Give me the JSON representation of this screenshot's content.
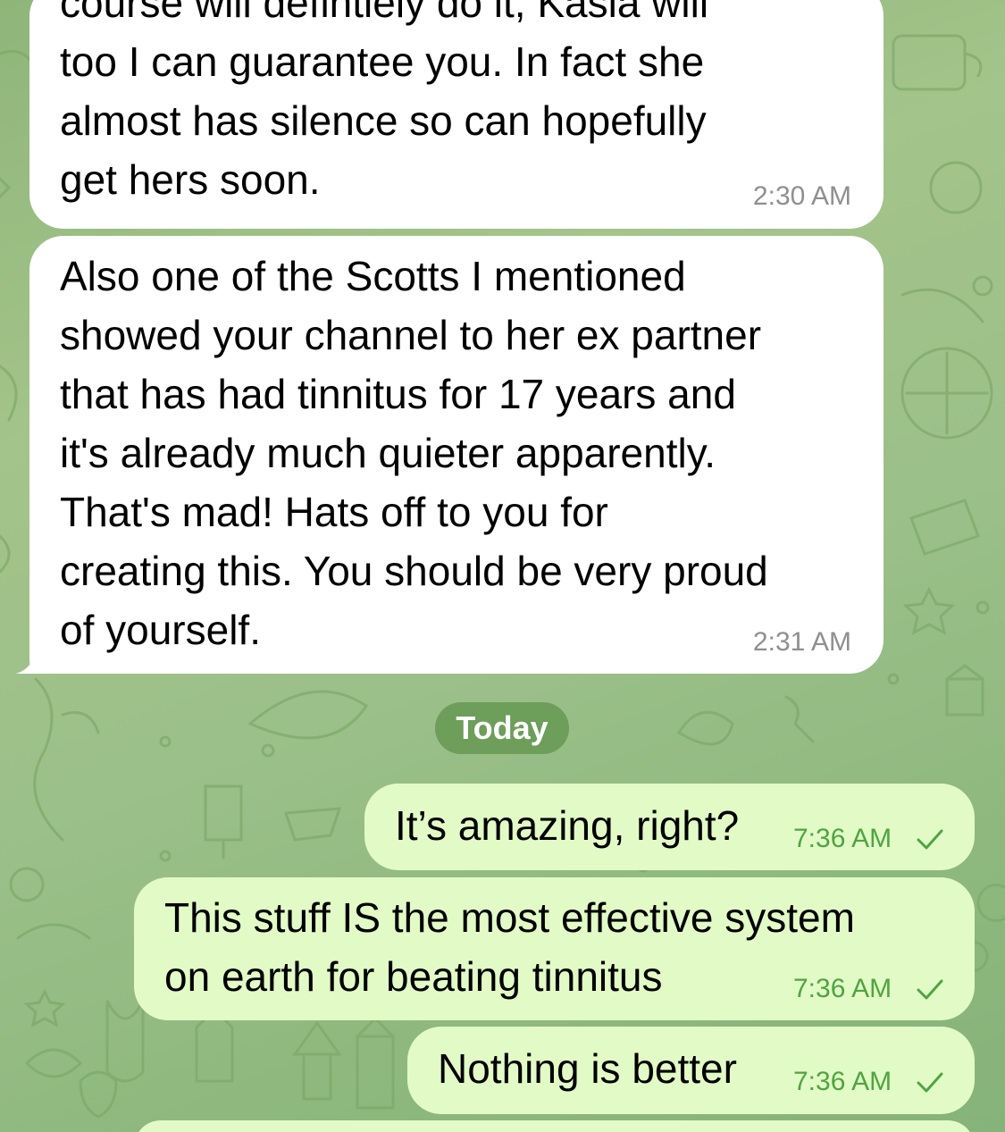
{
  "theme": {
    "incoming_bubble_color": "#ffffff",
    "outgoing_bubble_color": "#e2fbc6",
    "outgoing_time_color": "#4fa442",
    "incoming_time_color": "#8e8e93",
    "date_pill_color": "#6d9e5a"
  },
  "messages": [
    {
      "direction": "incoming",
      "text": "course will defintiely do it, Kasia will\ntoo I can guarantee you. In fact she\nalmost has silence so can hopefully\nget hers soon.",
      "time": "2:30 AM"
    },
    {
      "direction": "incoming",
      "text": "Also one of the Scotts I mentioned\nshowed your channel to her ex partner\nthat has had tinnitus for 17 years and\nit's already much quieter apparently.\nThat's mad! Hats off to you for\ncreating this. You should be very proud\nof yourself.",
      "time": "2:31 AM"
    }
  ],
  "date_separator": "Today",
  "outgoing": [
    {
      "direction": "outgoing",
      "text": "It’s amazing, right?",
      "time": "7:36 AM",
      "status_icon": "read-check-icon"
    },
    {
      "direction": "outgoing",
      "text": "This stuff IS the most effective system\non earth for beating tinnitus",
      "time": "7:36 AM",
      "status_icon": "read-check-icon"
    },
    {
      "direction": "outgoing",
      "text": "Nothing is better",
      "time": "7:36 AM",
      "status_icon": "read-check-icon"
    }
  ]
}
